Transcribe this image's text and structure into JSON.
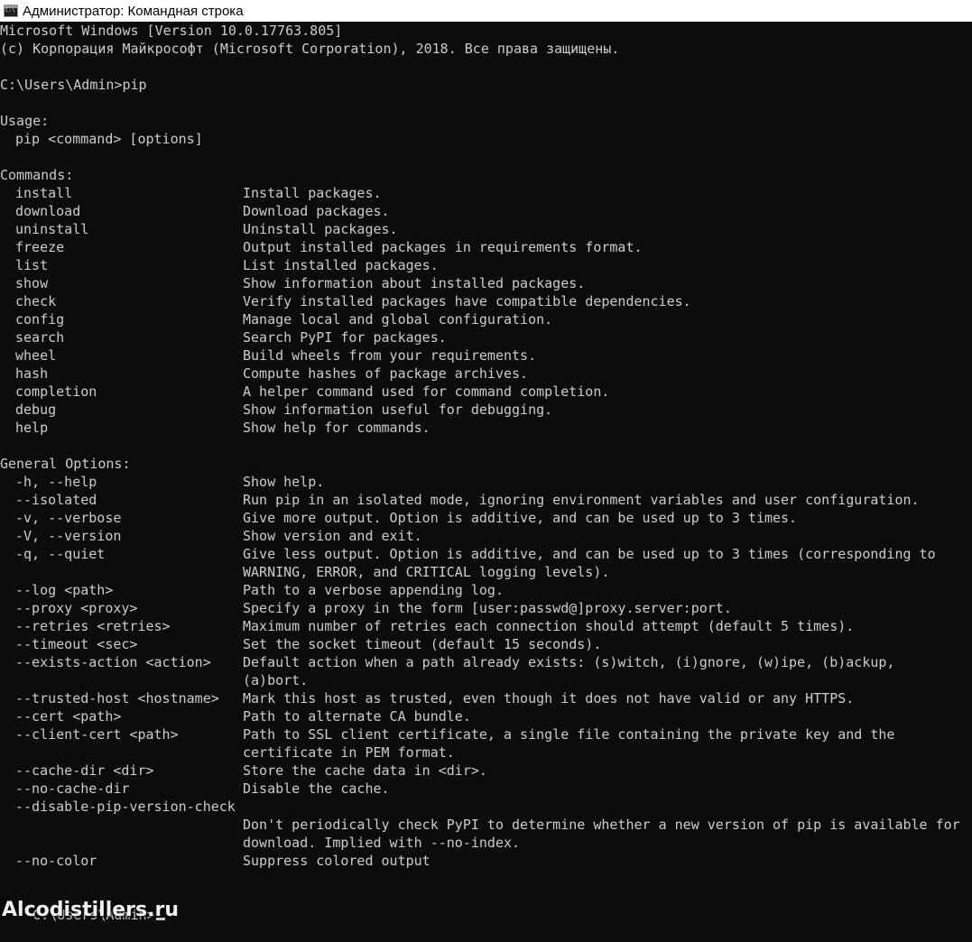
{
  "window": {
    "title": "Администратор: Командная строка",
    "icon": "cmd-icon"
  },
  "terminal": {
    "header": [
      "Microsoft Windows [Version 10.0.17763.805]",
      "(c) Корпорация Майкрософт (Microsoft Corporation), 2018. Все права защищены."
    ],
    "prompt_line": "C:\\Users\\Admin>pip",
    "usage_title": "Usage:",
    "usage_line": "pip <command> [options]",
    "commands_title": "Commands:",
    "commands": [
      [
        "install",
        "Install packages."
      ],
      [
        "download",
        "Download packages."
      ],
      [
        "uninstall",
        "Uninstall packages."
      ],
      [
        "freeze",
        "Output installed packages in requirements format."
      ],
      [
        "list",
        "List installed packages."
      ],
      [
        "show",
        "Show information about installed packages."
      ],
      [
        "check",
        "Verify installed packages have compatible dependencies."
      ],
      [
        "config",
        "Manage local and global configuration."
      ],
      [
        "search",
        "Search PyPI for packages."
      ],
      [
        "wheel",
        "Build wheels from your requirements."
      ],
      [
        "hash",
        "Compute hashes of package archives."
      ],
      [
        "completion",
        "A helper command used for command completion."
      ],
      [
        "debug",
        "Show information useful for debugging."
      ],
      [
        "help",
        "Show help for commands."
      ]
    ],
    "options_title": "General Options:",
    "options": [
      [
        "-h, --help",
        "Show help."
      ],
      [
        "--isolated",
        "Run pip in an isolated mode, ignoring environment variables and user configuration."
      ],
      [
        "-v, --verbose",
        "Give more output. Option is additive, and can be used up to 3 times."
      ],
      [
        "-V, --version",
        "Show version and exit."
      ],
      [
        "-q, --quiet",
        "Give less output. Option is additive, and can be used up to 3 times (corresponding to"
      ],
      [
        "",
        "WARNING, ERROR, and CRITICAL logging levels)."
      ],
      [
        "--log <path>",
        "Path to a verbose appending log."
      ],
      [
        "--proxy <proxy>",
        "Specify a proxy in the form [user:passwd@]proxy.server:port."
      ],
      [
        "--retries <retries>",
        "Maximum number of retries each connection should attempt (default 5 times)."
      ],
      [
        "--timeout <sec>",
        "Set the socket timeout (default 15 seconds)."
      ],
      [
        "--exists-action <action>",
        "Default action when a path already exists: (s)witch, (i)gnore, (w)ipe, (b)ackup,"
      ],
      [
        "",
        "(a)bort."
      ],
      [
        "--trusted-host <hostname>",
        "Mark this host as trusted, even though it does not have valid or any HTTPS."
      ],
      [
        "--cert <path>",
        "Path to alternate CA bundle."
      ],
      [
        "--client-cert <path>",
        "Path to SSL client certificate, a single file containing the private key and the"
      ],
      [
        "",
        "certificate in PEM format."
      ],
      [
        "--cache-dir <dir>",
        "Store the cache data in <dir>."
      ],
      [
        "--no-cache-dir",
        "Disable the cache."
      ],
      [
        "--disable-pip-version-check",
        ""
      ],
      [
        "",
        "Don't periodically check PyPI to determine whether a new version of pip is available for"
      ],
      [
        "",
        "download. Implied with --no-index."
      ],
      [
        "--no-color",
        "Suppress colored output"
      ]
    ],
    "final_prompt": "C:\\Users\\Admin>"
  },
  "watermark": "Alcodistillers.ru"
}
